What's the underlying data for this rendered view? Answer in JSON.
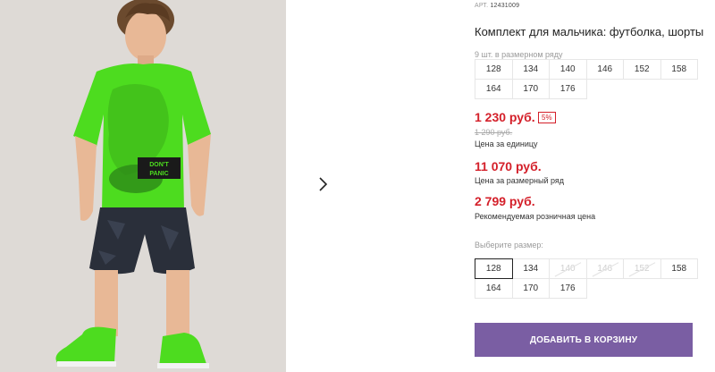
{
  "product": {
    "art_label": "АРТ.",
    "art_number": "12431009",
    "title": "Комплект для мальчика: футболка, шорты",
    "image_print_text": "DON'T PANIC"
  },
  "pack_sizes": {
    "label": "9 шт. в размерном ряду",
    "sizes": [
      "128",
      "134",
      "140",
      "146",
      "152",
      "158",
      "164",
      "170",
      "176"
    ]
  },
  "prices": {
    "unit_price": "1 230 руб.",
    "discount": "5%",
    "old_price": "1 290 руб.",
    "unit_label": "Цена за единицу",
    "row_price": "11 070 руб.",
    "row_label": "Цена за размерный ряд",
    "retail_price": "2 799 руб.",
    "retail_label": "Рекомендуемая розничная цена"
  },
  "size_select": {
    "label": "Выберите размер:",
    "selected": "128",
    "sizes": [
      "128",
      "134",
      "140",
      "146",
      "152",
      "158",
      "164",
      "170",
      "176"
    ],
    "disabled": [
      "140",
      "146",
      "152"
    ]
  },
  "actions": {
    "add_to_cart": "ДОБАВИТЬ В КОРЗИНУ"
  },
  "icons": {
    "next": "chevron-right-icon"
  },
  "colors": {
    "accent": "#7a5ea3",
    "price": "#d4202a",
    "shirt": "#4ddc1f"
  }
}
